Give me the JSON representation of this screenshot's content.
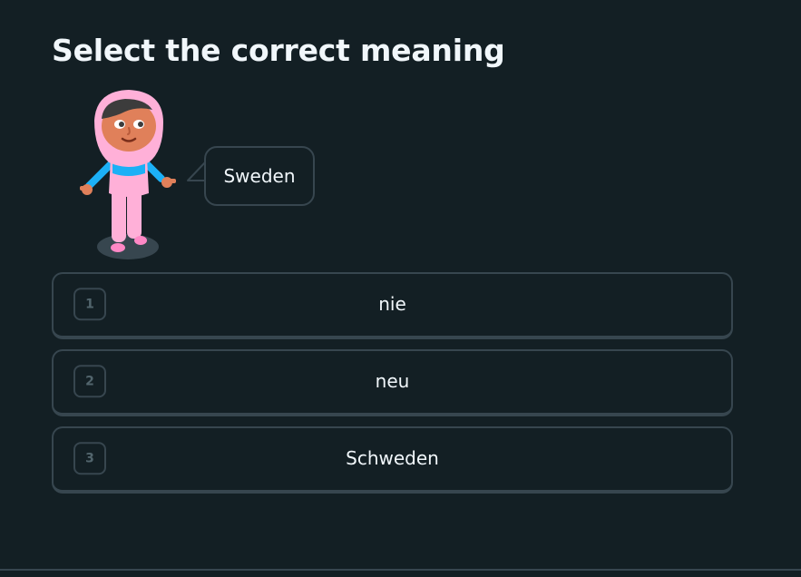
{
  "header": {
    "title": "Select the correct meaning"
  },
  "prompt": {
    "character": "hijab-girl-character",
    "speech_text": "Sweden"
  },
  "choices": [
    {
      "number": "1",
      "label": "nie"
    },
    {
      "number": "2",
      "label": "neu"
    },
    {
      "number": "3",
      "label": "Schweden"
    }
  ],
  "colors": {
    "background": "#131f24",
    "border": "#37464f",
    "text": "#f1f7fb",
    "muted": "#52656d"
  }
}
